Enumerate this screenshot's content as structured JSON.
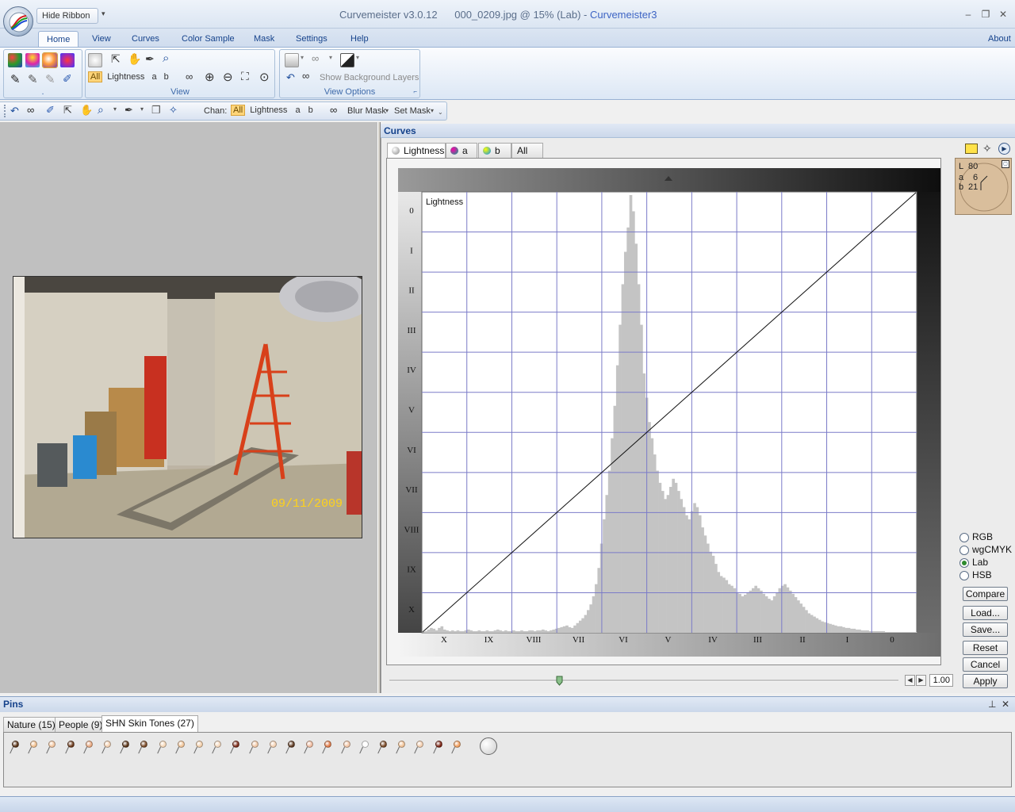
{
  "app": {
    "title": "Curvemeister v3.0.12",
    "document": "000_0209.jpg @ 15% (Lab) -",
    "brand": "Curvemeister3",
    "hide_ribbon": "Hide Ribbon",
    "about": "About"
  },
  "ribbon_tabs": [
    "Home",
    "View",
    "Curves",
    "Color Sample",
    "Mask",
    "Settings",
    "Help"
  ],
  "ribbon": {
    "group_view_label": "View",
    "group_view_options_label": "View Options",
    "group_edit_label": ".",
    "channel_all": "All",
    "channel_lightness": "Lightness",
    "channel_a": "a",
    "channel_b": "b",
    "show_bg_layers": "Show Background Layers"
  },
  "toolbar2": {
    "chan_label": "Chan:",
    "all": "All",
    "lightness": "Lightness",
    "a": "a",
    "b": "b",
    "blur_mask": "Blur Mask",
    "set_mask": "Set Mask"
  },
  "photo": {
    "date_stamp": "09/11/2009"
  },
  "curves": {
    "title": "Curves",
    "tabs": [
      "Lightness",
      "a",
      "b",
      "All"
    ],
    "graph_label": "Lightness",
    "y_zone_labels": [
      "0",
      "I",
      "II",
      "III",
      "IV",
      "V",
      "VI",
      "VII",
      "VIII",
      "IX",
      "X"
    ],
    "x_zone_labels": [
      "X",
      "IX",
      "VIII",
      "VII",
      "VI",
      "V",
      "IV",
      "III",
      "II",
      "I",
      "0"
    ],
    "slider_value": "1.00"
  },
  "sample": {
    "L_label": "L",
    "L_value": "80",
    "a_label": "a",
    "a_value": "6",
    "b_label": "b",
    "b_value": "21"
  },
  "color_modes": [
    {
      "label": "RGB",
      "selected": false
    },
    {
      "label": "wgCMYK",
      "selected": false
    },
    {
      "label": "Lab",
      "selected": true
    },
    {
      "label": "HSB",
      "selected": false
    }
  ],
  "buttons": {
    "compare": "Compare",
    "load": "Load...",
    "save": "Save...",
    "reset": "Reset",
    "cancel": "Cancel",
    "apply": "Apply"
  },
  "pins": {
    "title": "Pins",
    "tabs": [
      "Nature (15)",
      "People (9)",
      "SHN Skin Tones (27)"
    ],
    "active_tab": 2,
    "pin_colors": [
      "#5a3418",
      "#f1c090",
      "#f3c6a0",
      "#6b3a1c",
      "#e8a880",
      "#f4d0b0",
      "#5a3418",
      "#7a4a28",
      "#f6d8b8",
      "#f0c498",
      "#f3cfaa",
      "#f6d9bd",
      "#7a2a18",
      "#f2c8a6",
      "#f5d2b4",
      "#5e3a22",
      "#f0bca0",
      "#e07a48",
      "#f3c6a6",
      "#ffffff",
      "#7a4a28",
      "#f1c296",
      "#f4cfb0",
      "#7a2414",
      "#f2a060"
    ]
  },
  "histogram": [
    0,
    2,
    4,
    6,
    5,
    3,
    6,
    8,
    4,
    3,
    2,
    3,
    2,
    3,
    2,
    2,
    3,
    4,
    3,
    2,
    2,
    3,
    2,
    2,
    3,
    2,
    2,
    3,
    4,
    3,
    2,
    3,
    2,
    2,
    3,
    2,
    2,
    3,
    2,
    2,
    3,
    3,
    2,
    3,
    3,
    4,
    3,
    2,
    3,
    4,
    5,
    6,
    7,
    8,
    9,
    7,
    6,
    9,
    12,
    15,
    18,
    22,
    28,
    35,
    45,
    60,
    80,
    110,
    140,
    170,
    200,
    240,
    280,
    330,
    380,
    430,
    470,
    500,
    540,
    520,
    480,
    430,
    380,
    320,
    290,
    260,
    240,
    220,
    200,
    185,
    175,
    165,
    170,
    180,
    190,
    185,
    175,
    165,
    155,
    145,
    140,
    150,
    160,
    155,
    145,
    130,
    120,
    110,
    100,
    95,
    85,
    75,
    70,
    68,
    65,
    60,
    58,
    55,
    50,
    48,
    45,
    47,
    50,
    52,
    55,
    58,
    55,
    52,
    48,
    45,
    42,
    40,
    45,
    50,
    55,
    58,
    60,
    56,
    52,
    48,
    44,
    40,
    36,
    32,
    28,
    24,
    22,
    20,
    18,
    16,
    14,
    13,
    12,
    11,
    10,
    9,
    8,
    8,
    7,
    6,
    6,
    5,
    5,
    4,
    4,
    3,
    3,
    3,
    2,
    2,
    2,
    2,
    2,
    2,
    1,
    1,
    1,
    1,
    1,
    1,
    1,
    1,
    1,
    1,
    1,
    1
  ]
}
